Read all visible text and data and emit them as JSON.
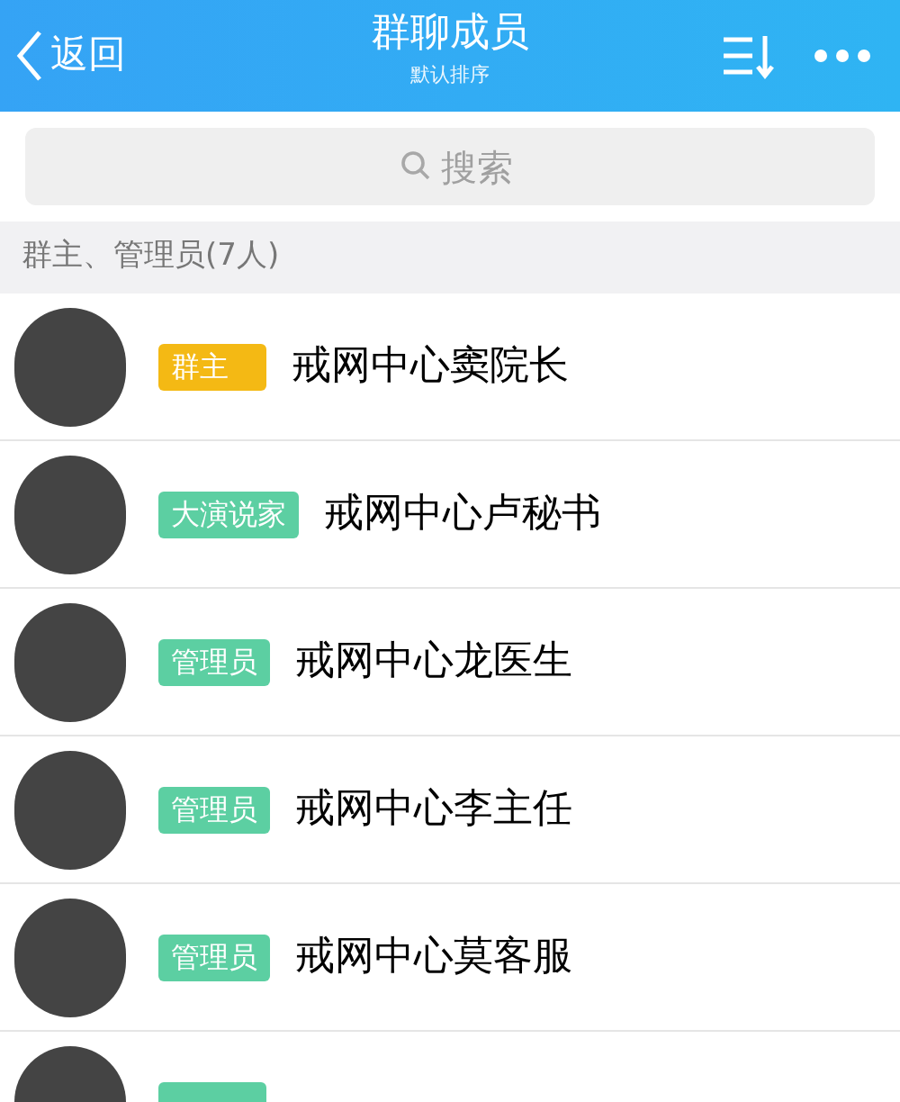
{
  "header": {
    "back": "返回",
    "title": "群聊成员",
    "subtitle": "默认排序"
  },
  "search": {
    "placeholder": "搜索"
  },
  "section": {
    "label": "群主、管理员(7人)"
  },
  "members": [
    {
      "badge": "群主",
      "color": "#f4b914",
      "name": "戒网中心窦院长"
    },
    {
      "badge": "大演说家",
      "color": "#5ccfa2",
      "name": "戒网中心卢秘书"
    },
    {
      "badge": "管理员",
      "color": "#5ccfa2",
      "name": "戒网中心龙医生"
    },
    {
      "badge": "管理员",
      "color": "#5ccfa2",
      "name": "戒网中心李主任"
    },
    {
      "badge": "管理员",
      "color": "#5ccfa2",
      "name": "戒网中心莫客服"
    },
    {
      "color": "#5ccfa2"
    }
  ]
}
